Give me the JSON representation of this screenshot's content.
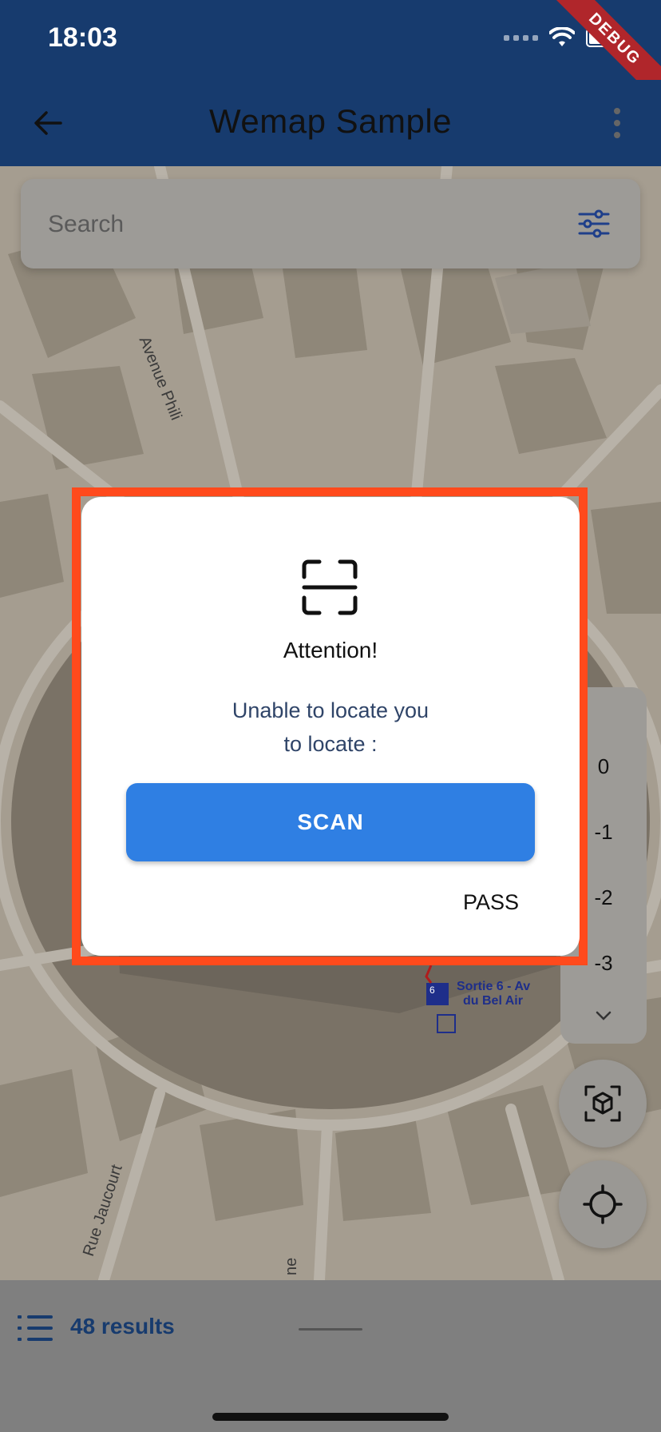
{
  "status_bar": {
    "time": "18:03",
    "debug_label": "DEBUG"
  },
  "app_bar": {
    "title": "Wemap Sample"
  },
  "search": {
    "placeholder": "Search"
  },
  "map": {
    "labels": {
      "street_philippe": "Avenue Phili",
      "street_jaucourt": "Rue Jaucourt",
      "street_bottom": "ne",
      "exit_line1": "Sortie 6 - Av",
      "exit_line2": "du Bel Air",
      "exit_badge": "6"
    }
  },
  "floor_selector": {
    "floors": [
      "0",
      "-1",
      "-2",
      "-3"
    ]
  },
  "dialog": {
    "title": "Attention!",
    "message_line1": "Unable to locate you",
    "message_line2": "to locate :",
    "scan_label": "SCAN",
    "pass_label": "PASS"
  },
  "bottom_sheet": {
    "results_label": "48 results"
  },
  "colors": {
    "app_bar": "#173b6e",
    "accent_blue": "#2f7fe3",
    "highlight": "#ff4a1c",
    "debug_banner": "#b0262b"
  }
}
